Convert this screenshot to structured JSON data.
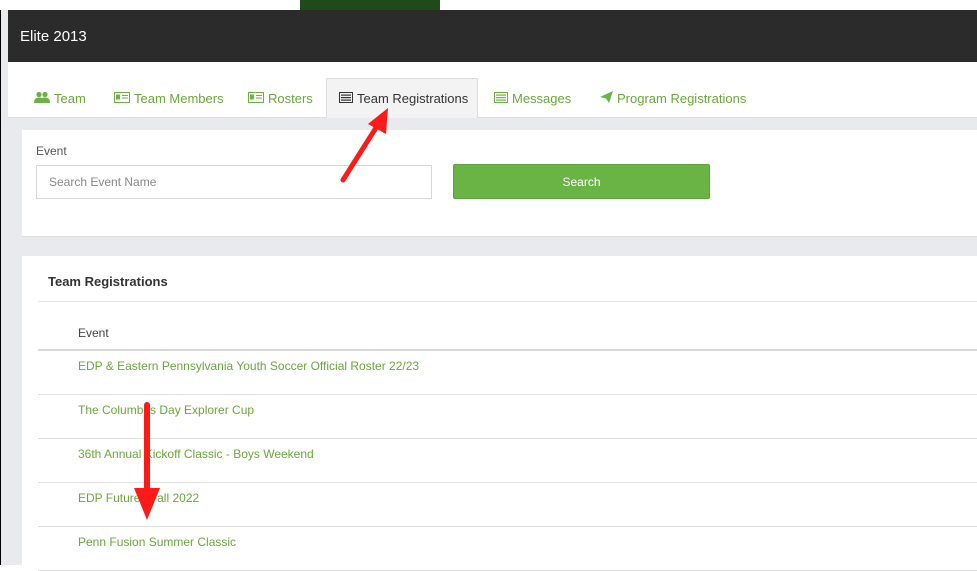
{
  "colors": {
    "accent": "#6ab446",
    "link": "#6aa83a",
    "titlebar": "#2b2b2b",
    "annotation": "#ff1a1a"
  },
  "header": {
    "title": "Elite 2013"
  },
  "tabs": [
    {
      "label": "Team",
      "icon": "users-icon"
    },
    {
      "label": "Team Members",
      "icon": "id-card-icon"
    },
    {
      "label": "Rosters",
      "icon": "id-card-icon"
    },
    {
      "label": "Team Registrations",
      "icon": "list-icon",
      "active": true
    },
    {
      "label": "Messages",
      "icon": "message-icon"
    },
    {
      "label": "Program Registrations",
      "icon": "paper-plane-icon"
    }
  ],
  "filter": {
    "label": "Event",
    "placeholder": "Search Event Name",
    "value": "",
    "search_label": "Search"
  },
  "results": {
    "title": "Team Registrations",
    "column_header": "Event",
    "rows": [
      "EDP & Eastern Pennsylvania Youth Soccer Official Roster 22/23",
      "The Columbus Day Explorer Cup",
      "36th Annual Kickoff Classic - Boys Weekend",
      "EDP Futures Fall 2022",
      "Penn Fusion Summer Classic"
    ]
  },
  "annotations": {
    "arrow_count": 2
  }
}
